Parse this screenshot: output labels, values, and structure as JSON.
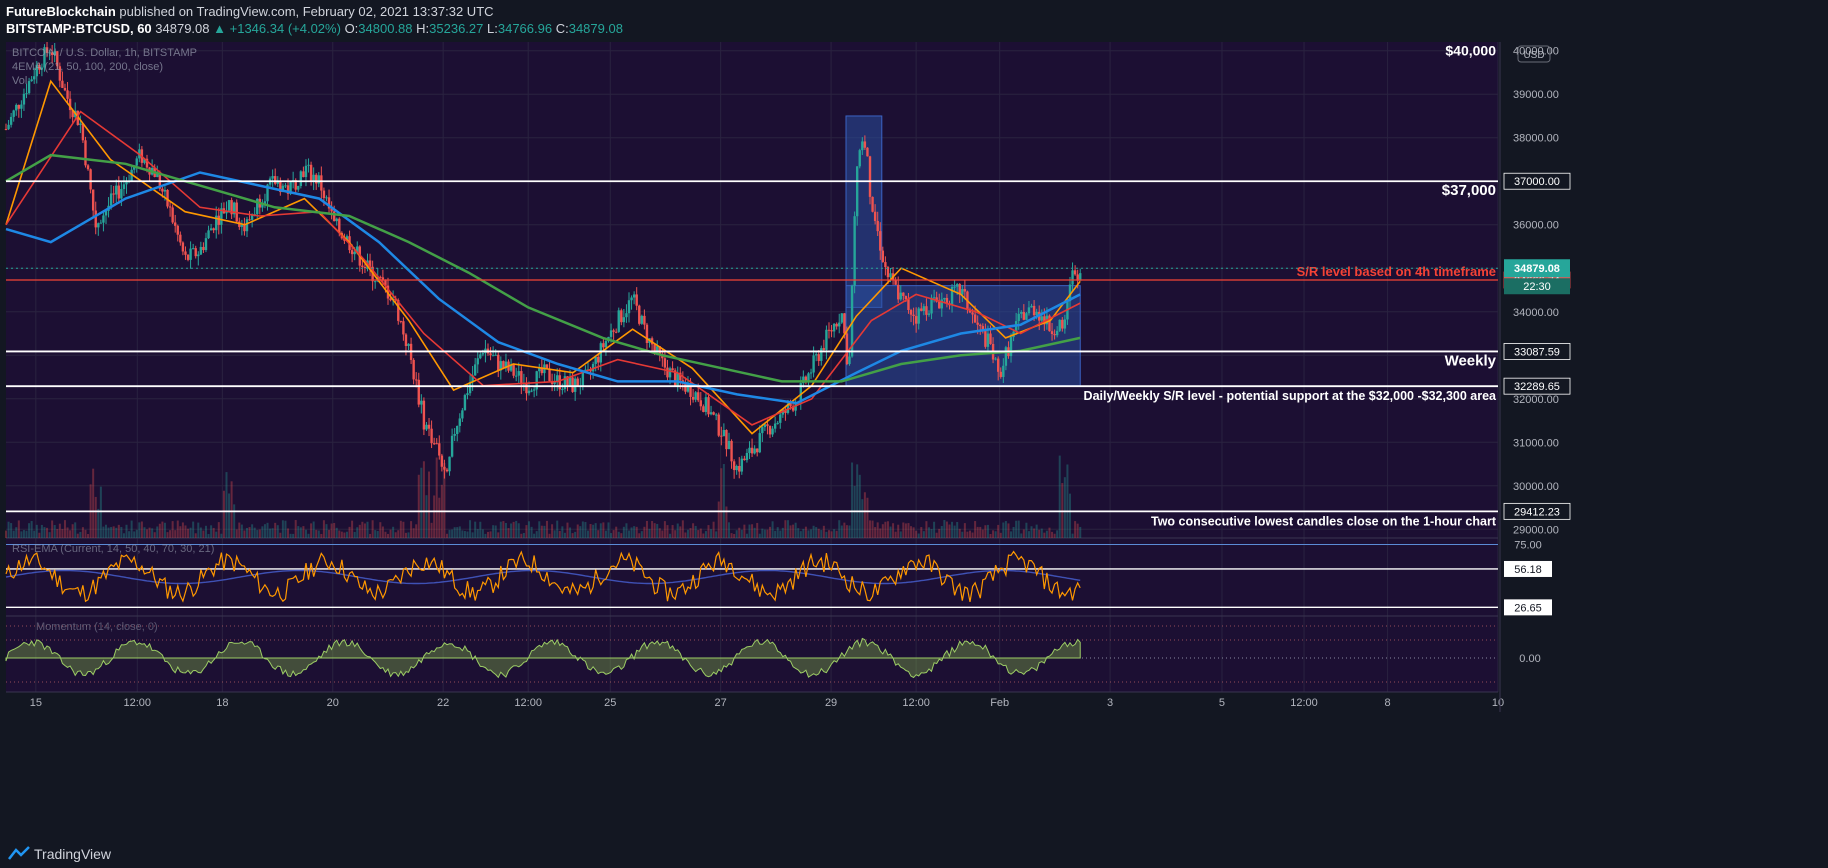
{
  "header": {
    "author": "FutureBlockchain",
    "published": "published on TradingView.com, February 02, 2021 13:37:32 UTC",
    "symbol": "BITSTAMP:BTCUSD, 60",
    "last": "34879.08",
    "change": "▲ +1346.34 (+4.02%)",
    "o_label": "O:",
    "o": "34800.88",
    "h_label": "H:",
    "h": "35236.27",
    "l_label": "L:",
    "l": "34766.96",
    "c_label": "C:",
    "c": "34879.08"
  },
  "footer": {
    "brand": "TradingView"
  },
  "colors": {
    "bg": "#1c0f33",
    "up": "#26a69a",
    "down": "#ef5350",
    "ma1": "#ff9800",
    "ma2": "#e53935",
    "ma3": "#1e88e5",
    "ma4": "#43a047",
    "sr": "#ffffff",
    "box": "#2a4f9e",
    "redline": "#f44336"
  },
  "chart_data": [
    {
      "type": "candlestick",
      "legend": [
        "BITCOIN / U.S. Dollar, 1h, BITSTAMP",
        "4EMA (21, 50, 100, 200, close)",
        "Vol"
      ],
      "currency": "USD",
      "ylim": [
        28800,
        40200
      ],
      "y_ticks": [
        29000,
        30000,
        31000,
        32000,
        33000,
        34000,
        35000,
        36000,
        37000,
        38000,
        39000,
        40000
      ],
      "y_tick_labels": [
        "29000.00",
        "30000.00",
        "31000.00",
        "32000.00",
        "33000.00",
        "34000.00",
        "35000.00",
        "36000.00",
        "37000.00",
        "38000.00",
        "39000.00",
        "40000.00"
      ],
      "x_ticks": [
        {
          "label": "15",
          "t": 0.02
        },
        {
          "label": "12:00",
          "t": 0.088
        },
        {
          "label": "18",
          "t": 0.145
        },
        {
          "label": "20",
          "t": 0.219
        },
        {
          "label": "22",
          "t": 0.293
        },
        {
          "label": "12:00",
          "t": 0.35
        },
        {
          "label": "25",
          "t": 0.405
        },
        {
          "label": "27",
          "t": 0.479
        },
        {
          "label": "29",
          "t": 0.553
        },
        {
          "label": "12:00",
          "t": 0.61
        },
        {
          "label": "Feb",
          "t": 0.666
        },
        {
          "label": "3",
          "t": 0.74
        },
        {
          "label": "5",
          "t": 0.815
        },
        {
          "label": "12:00",
          "t": 0.87
        },
        {
          "label": "8",
          "t": 0.926
        },
        {
          "label": "10",
          "t": 1.0
        }
      ],
      "candle_path": [
        [
          0,
          38200
        ],
        [
          0.02,
          39600
        ],
        [
          0.03,
          40100
        ],
        [
          0.04,
          39000
        ],
        [
          0.05,
          38300
        ],
        [
          0.06,
          36000
        ],
        [
          0.07,
          36500
        ],
        [
          0.08,
          37000
        ],
        [
          0.09,
          37600
        ],
        [
          0.1,
          37200
        ],
        [
          0.11,
          36300
        ],
        [
          0.12,
          35200
        ],
        [
          0.13,
          35400
        ],
        [
          0.14,
          36100
        ],
        [
          0.15,
          36500
        ],
        [
          0.16,
          35900
        ],
        [
          0.17,
          36600
        ],
        [
          0.18,
          37000
        ],
        [
          0.19,
          36800
        ],
        [
          0.2,
          37300
        ],
        [
          0.21,
          37000
        ],
        [
          0.22,
          36000
        ],
        [
          0.23,
          35600
        ],
        [
          0.24,
          35100
        ],
        [
          0.25,
          34700
        ],
        [
          0.26,
          34300
        ],
        [
          0.27,
          33100
        ],
        [
          0.28,
          31500
        ],
        [
          0.29,
          30800
        ],
        [
          0.295,
          30000
        ],
        [
          0.3,
          31200
        ],
        [
          0.31,
          32300
        ],
        [
          0.32,
          33200
        ],
        [
          0.33,
          32800
        ],
        [
          0.34,
          32600
        ],
        [
          0.35,
          32300
        ],
        [
          0.36,
          32600
        ],
        [
          0.37,
          32400
        ],
        [
          0.38,
          32300
        ],
        [
          0.39,
          32500
        ],
        [
          0.4,
          33200
        ],
        [
          0.41,
          33800
        ],
        [
          0.42,
          34300
        ],
        [
          0.43,
          33400
        ],
        [
          0.44,
          32800
        ],
        [
          0.45,
          32400
        ],
        [
          0.46,
          32200
        ],
        [
          0.47,
          31800
        ],
        [
          0.48,
          31200
        ],
        [
          0.49,
          30400
        ],
        [
          0.5,
          30800
        ],
        [
          0.51,
          31300
        ],
        [
          0.52,
          31600
        ],
        [
          0.53,
          32000
        ],
        [
          0.54,
          32700
        ],
        [
          0.55,
          33400
        ],
        [
          0.56,
          34000
        ],
        [
          0.565,
          32600
        ],
        [
          0.57,
          37300
        ],
        [
          0.575,
          38200
        ],
        [
          0.58,
          36500
        ],
        [
          0.59,
          34900
        ],
        [
          0.6,
          34300
        ],
        [
          0.61,
          33900
        ],
        [
          0.62,
          34200
        ],
        [
          0.63,
          34300
        ],
        [
          0.64,
          34500
        ],
        [
          0.65,
          33700
        ],
        [
          0.66,
          33200
        ],
        [
          0.665,
          32500
        ],
        [
          0.67,
          33000
        ],
        [
          0.68,
          33900
        ],
        [
          0.69,
          34100
        ],
        [
          0.7,
          33600
        ],
        [
          0.71,
          33800
        ],
        [
          0.715,
          34900
        ],
        [
          0.72,
          34900
        ]
      ],
      "volume_spikes": [
        0.06,
        0.15,
        0.28,
        0.29,
        0.48,
        0.57,
        0.575,
        0.71
      ],
      "ema_21": [
        [
          0,
          36000
        ],
        [
          0.03,
          39300
        ],
        [
          0.07,
          37500
        ],
        [
          0.12,
          36300
        ],
        [
          0.16,
          36000
        ],
        [
          0.2,
          36600
        ],
        [
          0.23,
          35600
        ],
        [
          0.27,
          33800
        ],
        [
          0.3,
          32200
        ],
        [
          0.34,
          32800
        ],
        [
          0.38,
          32600
        ],
        [
          0.42,
          33600
        ],
        [
          0.46,
          32700
        ],
        [
          0.5,
          31200
        ],
        [
          0.54,
          32300
        ],
        [
          0.57,
          33900
        ],
        [
          0.6,
          35000
        ],
        [
          0.64,
          34400
        ],
        [
          0.67,
          33400
        ],
        [
          0.7,
          33800
        ],
        [
          0.72,
          34700
        ]
      ],
      "ema_50": [
        [
          0,
          36000
        ],
        [
          0.05,
          38600
        ],
        [
          0.09,
          37600
        ],
        [
          0.13,
          36400
        ],
        [
          0.17,
          36200
        ],
        [
          0.21,
          36300
        ],
        [
          0.24,
          35200
        ],
        [
          0.28,
          33500
        ],
        [
          0.32,
          32300
        ],
        [
          0.37,
          32400
        ],
        [
          0.41,
          32900
        ],
        [
          0.45,
          32600
        ],
        [
          0.5,
          31400
        ],
        [
          0.54,
          32000
        ],
        [
          0.58,
          33800
        ],
        [
          0.61,
          34400
        ],
        [
          0.65,
          34000
        ],
        [
          0.68,
          33500
        ],
        [
          0.72,
          34200
        ]
      ],
      "ema_100": [
        [
          0,
          35900
        ],
        [
          0.03,
          35600
        ],
        [
          0.08,
          36600
        ],
        [
          0.13,
          37200
        ],
        [
          0.17,
          36900
        ],
        [
          0.21,
          36600
        ],
        [
          0.25,
          35600
        ],
        [
          0.29,
          34300
        ],
        [
          0.33,
          33300
        ],
        [
          0.37,
          32800
        ],
        [
          0.41,
          32400
        ],
        [
          0.45,
          32400
        ],
        [
          0.49,
          32100
        ],
        [
          0.53,
          31900
        ],
        [
          0.57,
          32600
        ],
        [
          0.6,
          33100
        ],
        [
          0.64,
          33500
        ],
        [
          0.68,
          33700
        ],
        [
          0.72,
          34400
        ]
      ],
      "ema_200": [
        [
          0,
          37000
        ],
        [
          0.03,
          37600
        ],
        [
          0.08,
          37400
        ],
        [
          0.13,
          36900
        ],
        [
          0.18,
          36400
        ],
        [
          0.23,
          36200
        ],
        [
          0.27,
          35600
        ],
        [
          0.31,
          34900
        ],
        [
          0.35,
          34100
        ],
        [
          0.4,
          33400
        ],
        [
          0.44,
          33000
        ],
        [
          0.48,
          32700
        ],
        [
          0.52,
          32400
        ],
        [
          0.56,
          32400
        ],
        [
          0.6,
          32800
        ],
        [
          0.64,
          33000
        ],
        [
          0.68,
          33100
        ],
        [
          0.72,
          33400
        ]
      ],
      "levels": [
        {
          "price": 37000,
          "label": "$37,000",
          "axis": "37000.00"
        },
        {
          "price": 34730,
          "label": "S/R level based on 4h timeframe",
          "axis": "34666.74",
          "style": "red"
        },
        {
          "price": 33087.59,
          "label": "Weekly",
          "axis": "33087.59"
        },
        {
          "price": 32289.65,
          "label": "Daily/Weekly S/R level - potential support at the $32,000 -$32,300 area",
          "axis": "32289.65"
        },
        {
          "price": 29412.23,
          "label": "Two consecutive lowest candles close on the 1-hour chart",
          "axis": "29412.23"
        }
      ],
      "top_label": "$40,000",
      "price_tag": "34879.08",
      "countdown": "22:30",
      "boxes": [
        {
          "t0": 0.563,
          "t1": 0.587,
          "p0": 34100,
          "p1": 38500
        },
        {
          "t0": 0.563,
          "t1": 0.72,
          "p0": 32300,
          "p1": 34600
        }
      ]
    },
    {
      "type": "line",
      "name": "RSI",
      "legend": "RSI-EMA (Current, 14, 50, 40, 70, 30, 21)",
      "ylim": [
        20,
        80
      ],
      "bands": [
        75,
        56.18,
        26.65
      ],
      "band_labels": [
        "75.00",
        "56.18",
        "26.65"
      ],
      "value": "56.18"
    },
    {
      "type": "line",
      "name": "Oscillator",
      "legend": "Momentum (14, close, 0)",
      "zero_label": "0.00"
    }
  ]
}
